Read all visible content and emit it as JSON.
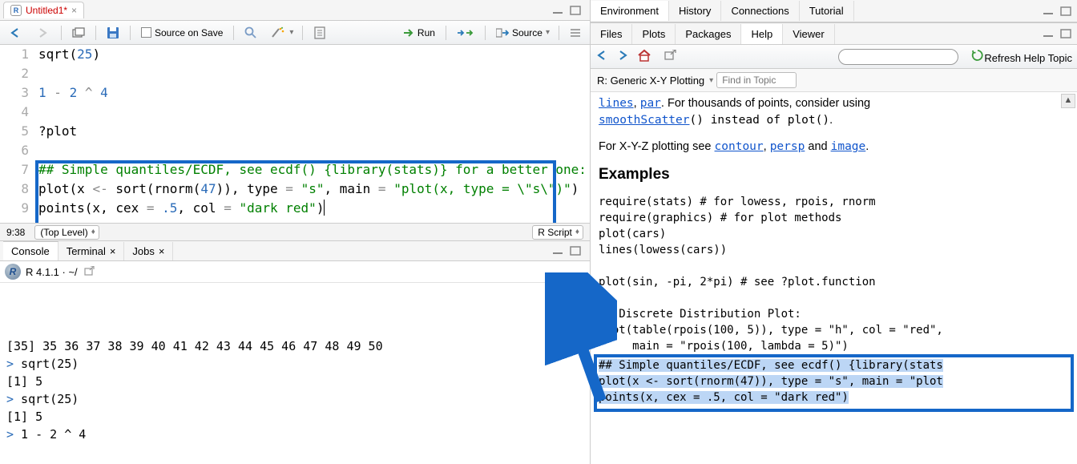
{
  "source_tab": {
    "title": "Untitled1*",
    "dirty": true
  },
  "source_toolbar": {
    "source_on_save": "Source on Save",
    "run": "Run",
    "source": "Source"
  },
  "editor": {
    "lines": [
      {
        "n": 1,
        "frag": [
          [
            "fn",
            "sqrt"
          ],
          [
            "p",
            "("
          ],
          [
            "num",
            "25"
          ],
          [
            "p",
            ")"
          ]
        ]
      },
      {
        "n": 2,
        "frag": []
      },
      {
        "n": 3,
        "frag": [
          [
            "num",
            "1"
          ],
          [
            "p",
            " "
          ],
          [
            "op",
            "-"
          ],
          [
            "p",
            " "
          ],
          [
            "num",
            "2"
          ],
          [
            "p",
            " "
          ],
          [
            "op",
            "^"
          ],
          [
            "p",
            " "
          ],
          [
            "num",
            "4"
          ]
        ]
      },
      {
        "n": 4,
        "frag": []
      },
      {
        "n": 5,
        "frag": [
          [
            "p",
            "?plot"
          ]
        ]
      },
      {
        "n": 6,
        "frag": []
      },
      {
        "n": 7,
        "frag": [
          [
            "cmt",
            "## Simple quantiles/ECDF, see ecdf() {library(stats)} for a better one:"
          ]
        ]
      },
      {
        "n": 8,
        "frag": [
          [
            "fn",
            "plot"
          ],
          [
            "p",
            "(x "
          ],
          [
            "op",
            "<-"
          ],
          [
            "p",
            " "
          ],
          [
            "fn",
            "sort"
          ],
          [
            "p",
            "("
          ],
          [
            "fn",
            "rnorm"
          ],
          [
            "p",
            "("
          ],
          [
            "num",
            "47"
          ],
          [
            "p",
            ")), type "
          ],
          [
            "op",
            "="
          ],
          [
            "p",
            " "
          ],
          [
            "str",
            "\"s\""
          ],
          [
            "p",
            ", main "
          ],
          [
            "op",
            "="
          ],
          [
            "p",
            " "
          ],
          [
            "str",
            "\"plot(x, type = \\\"s\\\")\""
          ],
          [
            "p",
            ")"
          ]
        ]
      },
      {
        "n": 9,
        "frag": [
          [
            "fn",
            "points"
          ],
          [
            "p",
            "(x, cex "
          ],
          [
            "op",
            "="
          ],
          [
            "p",
            " "
          ],
          [
            "num",
            ".5"
          ],
          [
            "p",
            ", col "
          ],
          [
            "op",
            "="
          ],
          [
            "p",
            " "
          ],
          [
            "str",
            "\"dark red\""
          ],
          [
            "p",
            ")"
          ]
        ]
      }
    ],
    "cursor_pos": "9:38",
    "scope": "(Top Level)",
    "filetype": "R Script"
  },
  "console": {
    "tabs": {
      "console": "Console",
      "terminal": "Terminal",
      "jobs": "Jobs"
    },
    "header": "R 4.1.1 · ~/",
    "lines": [
      "[35] 35 36 37 38 39 40 41 42 43 44 45 46 47 48 49 50",
      "> sqrt(25)",
      "[1] 5",
      "> sqrt(25)",
      "[1] 5",
      "> 1 - 2 ^ 4"
    ]
  },
  "env_tabs": {
    "environment": "Environment",
    "history": "History",
    "connections": "Connections",
    "tutorial": "Tutorial"
  },
  "file_tabs": {
    "files": "Files",
    "plots": "Plots",
    "packages": "Packages",
    "help": "Help",
    "viewer": "Viewer"
  },
  "help_toolbar": {
    "search_placeholder": "",
    "refresh": "Refresh Help Topic"
  },
  "help_subhdr": {
    "title": "R: Generic X-Y Plotting",
    "find_placeholder": "Find in Topic"
  },
  "help": {
    "frag_top1": ", ",
    "frag_top2": ". For thousands of points, consider using ",
    "link_lines": "lines",
    "link_par": "par",
    "link_smooth": "smoothScatter",
    "frag_instead": "() instead of ",
    "code_plot": "plot()",
    "frag_period": ".",
    "xyz1": "For X-Y-Z plotting see ",
    "link_contour": "contour",
    "xyz2": ", ",
    "link_persp": "persp",
    "xyz3": " and ",
    "link_image": "image",
    "examples_hdr": "Examples",
    "pre": "require(stats) # for lowess, rpois, rnorm\nrequire(graphics) # for plot methods\nplot(cars)\nlines(lowess(cars))\n\nplot(sin, -pi, 2*pi) # see ?plot.function\n\n## Discrete Distribution Plot:\nplot(table(rpois(100, 5)), type = \"h\", col = \"red\",\n     main = \"rpois(100, lambda = 5)\")\n",
    "selected": "## Simple quantiles/ECDF, see ecdf() {library(stats\nplot(x <- sort(rnorm(47)), type = \"s\", main = \"plot\npoints(x, cex = .5, col = \"dark red\")"
  },
  "icons": {
    "back": "←",
    "fwd": "→",
    "home": "home",
    "popout": "↗",
    "refresh": "↻",
    "save": "save",
    "search": "search",
    "wand": "wand",
    "notebook": "notebook",
    "run": "run",
    "rerun": "rerun",
    "source": "source",
    "chevron": "▾"
  }
}
